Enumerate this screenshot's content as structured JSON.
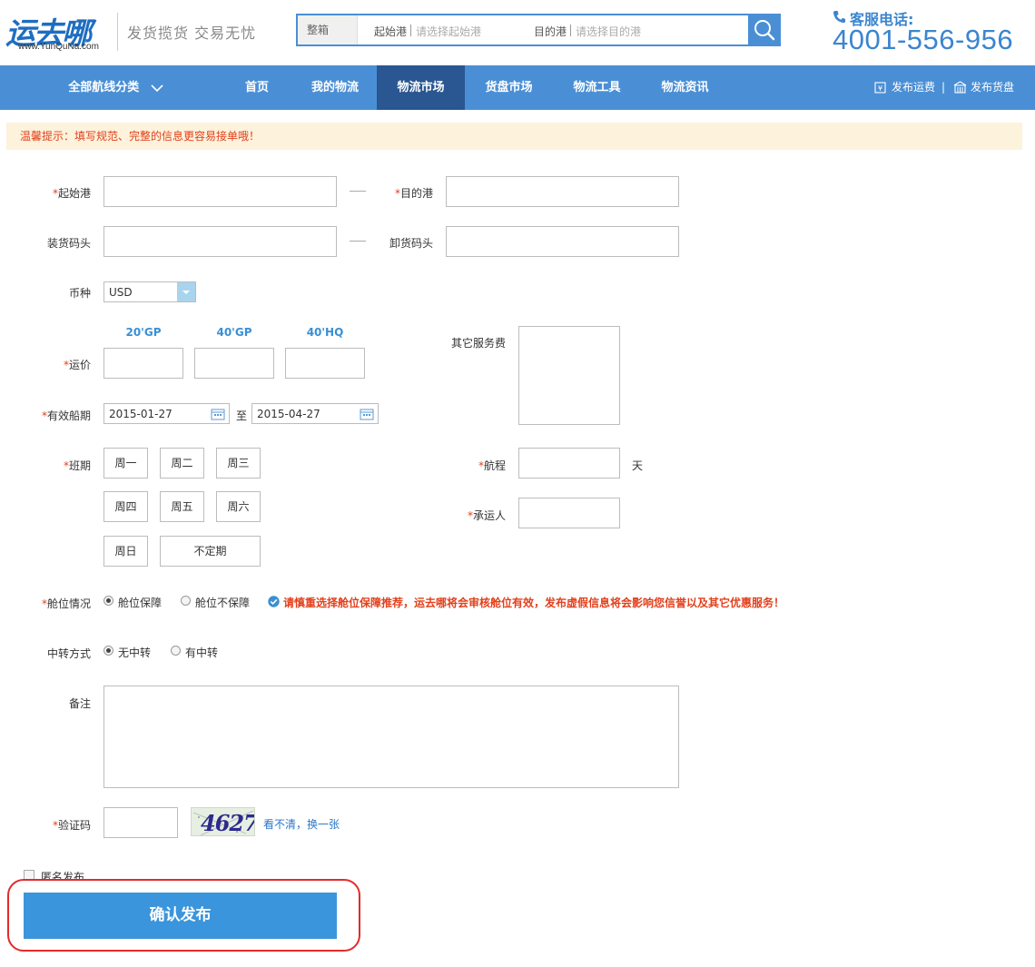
{
  "header": {
    "logo_text": "运去哪",
    "logo_domain": "www.YunQuNa.com",
    "slogan": "发货揽货  交易无忧",
    "search": {
      "type": "整箱",
      "origin_label": "起始港",
      "origin_placeholder": "请选择起始港",
      "dest_label": "目的港",
      "dest_placeholder": "请选择目的港"
    },
    "phone_label": "客服电话:",
    "phone_number": "4001-556-956"
  },
  "nav": {
    "category": "全部航线分类",
    "items": [
      "首页",
      "我的物流",
      "物流市场",
      "货盘市场",
      "物流工具",
      "物流资讯"
    ],
    "active": "物流市场",
    "right_links": [
      "发布运费",
      "发布货盘"
    ],
    "separator": "|"
  },
  "tip": "温馨提示：填写规范、完整的信息更容易接单哦！",
  "form": {
    "required_mark": "*",
    "origin_port_label": "起始港",
    "dest_port_label": "目的港",
    "loading_wharf_label": "装货码头",
    "unloading_wharf_label": "卸货码头",
    "currency_label": "币种",
    "currency_value": "USD",
    "container_types": [
      "20'GP",
      "40'GP",
      "40'HQ"
    ],
    "freight_label": "运价",
    "other_fees_label": "其它服务费",
    "validity_label": "有效船期",
    "validity_from": "2015-01-27",
    "validity_to_sep": "至",
    "validity_to": "2015-04-27",
    "schedule_label": "班期",
    "days": [
      "周一",
      "周二",
      "周三",
      "周四",
      "周五",
      "周六",
      "周日",
      "不定期"
    ],
    "voyage_label": "航程",
    "voyage_unit": "天",
    "carrier_label": "承运人",
    "space_label": "舱位情况",
    "space_options": [
      "舱位保障",
      "舱位不保障"
    ],
    "space_selected": "舱位保障",
    "space_warning": "请慎重选择舱位保障推荐，运去哪将会审核舱位有效，发布虚假信息将会影响您信誉以及其它优惠服务！",
    "transit_label": "中转方式",
    "transit_options": [
      "无中转",
      "有中转"
    ],
    "transit_selected": "无中转",
    "remarks_label": "备注",
    "captcha_label": "验证码",
    "captcha_image_text": "4627",
    "captcha_refresh": "看不清，换一张",
    "anonymous_label": "匿名发布",
    "submit_label": "确认发布"
  },
  "colors": {
    "brand_blue": "#4a8fd6",
    "nav_active": "#2a5691",
    "required_red": "#e2401c",
    "submit_blue": "#3a95dc",
    "highlight_ring": "#e32a2a"
  }
}
